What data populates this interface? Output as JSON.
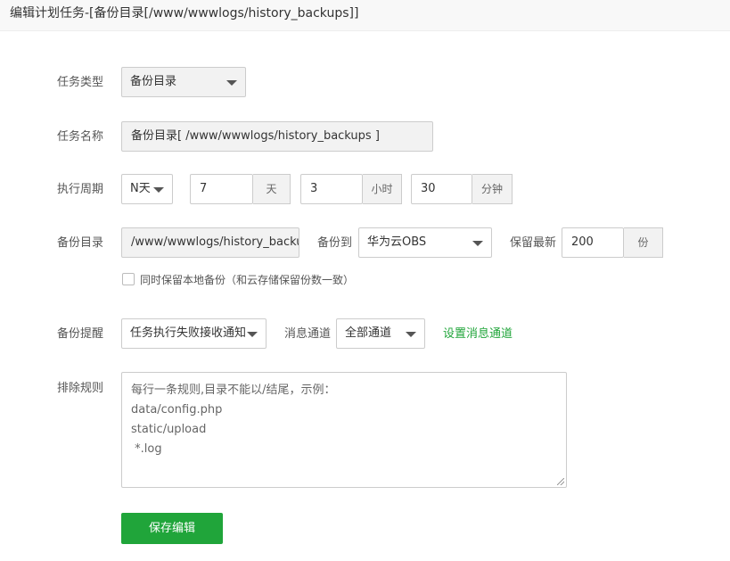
{
  "window": {
    "title": "编辑计划任务-[备份目录[/www/wwwlogs/history_backups]]"
  },
  "form": {
    "task_type": {
      "label": "任务类型",
      "value": "备份目录"
    },
    "task_name": {
      "label": "任务名称",
      "value": "备份目录[ /www/wwwlogs/history_backups ]"
    },
    "cycle": {
      "label": "执行周期",
      "mode": "N天",
      "days": {
        "value": "7",
        "unit": "天"
      },
      "hours": {
        "value": "3",
        "unit": "小时"
      },
      "minutes": {
        "value": "30",
        "unit": "分钟"
      }
    },
    "backup_dir": {
      "label": "备份目录",
      "value": "/www/wwwlogs/history_backups",
      "backup_to_label": "备份到",
      "backup_to_value": "华为云OBS",
      "keep_label": "保留最新",
      "keep_value": "200",
      "keep_unit": "份"
    },
    "keep_local": {
      "label": "同时保留本地备份（和云存储保留份数一致）",
      "checked": false
    },
    "notify": {
      "label": "备份提醒",
      "value": "任务执行失败接收通知",
      "channel_label": "消息通道",
      "channel_value": "全部通道",
      "channel_link": "设置消息通道"
    },
    "exclude": {
      "label": "排除规则",
      "placeholder_lines": [
        "每行一条规则,目录不能以/结尾，示例：",
        "data/config.php",
        "static/upload",
        " *.log"
      ]
    },
    "save_button": "保存编辑"
  }
}
